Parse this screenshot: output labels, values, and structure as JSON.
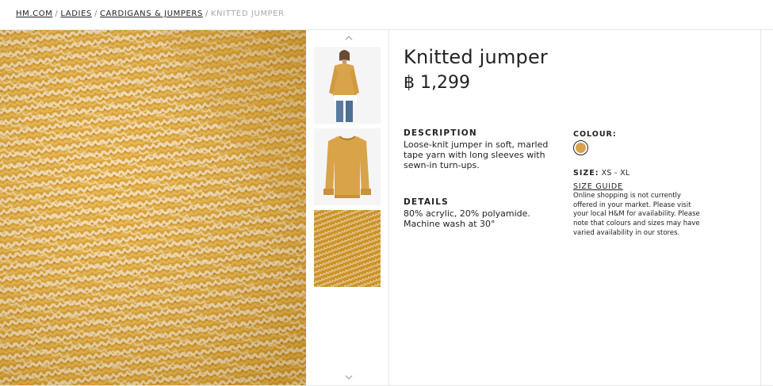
{
  "breadcrumb": {
    "items": [
      "HM.COM",
      "LADIES",
      "CARDIGANS & JUMPERS"
    ],
    "separator": "/",
    "current": "KNITTED JUMPER"
  },
  "product": {
    "title": "Knitted jumper",
    "price": "฿ 1,299"
  },
  "description": {
    "heading": "DESCRIPTION",
    "text": "Loose-knit jumper in soft, marled tape yarn with long sleeves with sewn-in turn-ups."
  },
  "details": {
    "heading": "DETAILS",
    "text": "80% acrylic, 20% polyamide. Machine wash at 30°"
  },
  "colour": {
    "label": "COLOUR:",
    "swatch_color": "#d9a24a"
  },
  "size": {
    "label": "SIZE:",
    "range": "XS - XL",
    "guide_label": "SIZE GUIDE"
  },
  "availability_text": "Online shopping is not currently offered in your market. Please visit your local H&M for availability. Please note that colours and sizes may have varied availability in our stores.",
  "icons": {
    "thumb_up": "chevron-up-icon",
    "thumb_down": "chevron-down-icon"
  },
  "colors": {
    "knit_yellow": "#d9a030",
    "knit_cream": "#f0d5a8",
    "text": "#222222"
  }
}
